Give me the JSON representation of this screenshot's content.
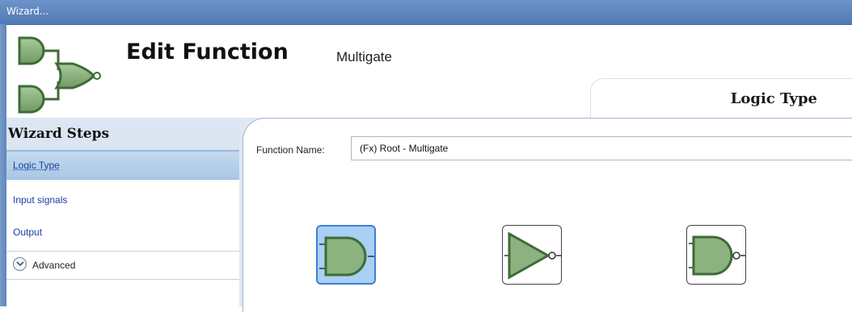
{
  "window": {
    "title": "Wizard..."
  },
  "header": {
    "title": "Edit Function",
    "subtitle": "Multigate",
    "step_tab": "Logic Type"
  },
  "sidebar": {
    "title": "Wizard Steps",
    "steps": [
      {
        "label": "Logic Type",
        "active": true
      },
      {
        "label": "Input signals",
        "active": false
      },
      {
        "label": "Output",
        "active": false
      }
    ],
    "advanced_label": "Advanced"
  },
  "form": {
    "function_name_label": "Function Name:",
    "function_name_value": "(Fx) Root - Multigate"
  },
  "gates": [
    {
      "icon": "and-gate-icon",
      "selected": true
    },
    {
      "icon": "not-gate-icon",
      "selected": false
    },
    {
      "icon": "nand-gate-icon",
      "selected": false
    }
  ],
  "colors": {
    "gate_fill": "#8bb27f",
    "gate_stroke": "#3f6b36",
    "title_bar": "#5f86bd",
    "selected": "#a9d0f5"
  }
}
